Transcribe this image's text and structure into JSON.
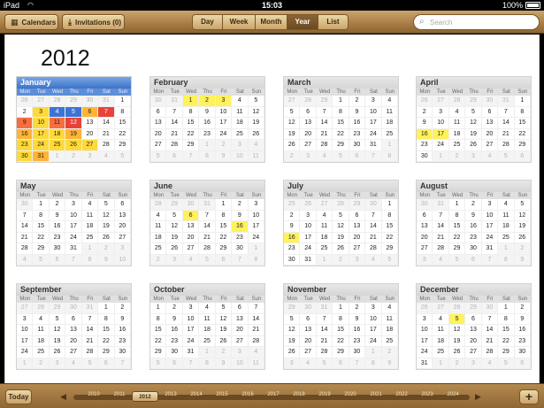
{
  "status_bar": {
    "device": "iPad",
    "time": "15:03",
    "battery": "100%"
  },
  "toolbar": {
    "calendars_label": "Calendars",
    "invitations_label": "Invitations (0)",
    "views": [
      "Day",
      "Week",
      "Month",
      "Year",
      "List"
    ],
    "active_view": "Year",
    "search_placeholder": "Search"
  },
  "year": "2012",
  "weekdays": [
    "Mon",
    "Tue",
    "Wed",
    "Thu",
    "Fri",
    "Sat",
    "Sun"
  ],
  "months": [
    {
      "name": "January",
      "offset": 6,
      "days": 31,
      "prev_days": 31,
      "selected": true,
      "events": [
        3,
        4,
        5,
        6,
        7,
        9,
        10,
        11,
        12,
        16,
        17,
        18,
        19,
        23,
        24,
        25,
        26,
        27,
        30,
        31
      ],
      "heat": {
        "3": 1,
        "4": 5,
        "5": 5,
        "6": 2,
        "7": 4,
        "9": 3,
        "10": 1,
        "11": 3,
        "12": 4,
        "16": 2,
        "17": 1,
        "18": 1,
        "19": 2,
        "23": 1,
        "24": 1,
        "25": 1,
        "26": 1,
        "27": 1,
        "30": 1,
        "31": 2
      }
    },
    {
      "name": "February",
      "offset": 2,
      "days": 29,
      "prev_days": 31,
      "events": [
        1,
        2,
        3
      ],
      "heat": {}
    },
    {
      "name": "March",
      "offset": 3,
      "days": 31,
      "prev_days": 29,
      "events": [],
      "heat": {}
    },
    {
      "name": "April",
      "offset": 6,
      "days": 30,
      "prev_days": 31,
      "events": [
        16,
        17
      ],
      "heat": {}
    },
    {
      "name": "May",
      "offset": 1,
      "days": 31,
      "prev_days": 30,
      "events": [],
      "heat": {}
    },
    {
      "name": "June",
      "offset": 4,
      "days": 30,
      "prev_days": 31,
      "events": [
        6,
        16
      ],
      "heat": {}
    },
    {
      "name": "July",
      "offset": 6,
      "days": 31,
      "prev_days": 30,
      "events": [
        16
      ],
      "heat": {}
    },
    {
      "name": "August",
      "offset": 2,
      "days": 31,
      "prev_days": 31,
      "events": [],
      "heat": {}
    },
    {
      "name": "September",
      "offset": 5,
      "days": 30,
      "prev_days": 31,
      "events": [],
      "heat": {}
    },
    {
      "name": "October",
      "offset": 0,
      "days": 31,
      "prev_days": 30,
      "events": [],
      "heat": {}
    },
    {
      "name": "November",
      "offset": 3,
      "days": 30,
      "prev_days": 31,
      "events": [],
      "heat": {}
    },
    {
      "name": "December",
      "offset": 5,
      "days": 31,
      "prev_days": 30,
      "events": [
        5
      ],
      "heat": {}
    }
  ],
  "bottom": {
    "today_label": "Today",
    "timeline_years": [
      "2010",
      "2011",
      "2012",
      "2013",
      "2014",
      "2015",
      "2016",
      "2017",
      "2018",
      "2019",
      "2020",
      "2021",
      "2022",
      "2023",
      "2024"
    ],
    "active_year": "2012",
    "prev_icon": "left-triangle-icon",
    "next_icon": "right-triangle-icon",
    "add_icon": "plus-icon"
  },
  "colors": {
    "event": "#fff25a",
    "selected_header": "#3d73c9",
    "leather": "#a87c44"
  }
}
